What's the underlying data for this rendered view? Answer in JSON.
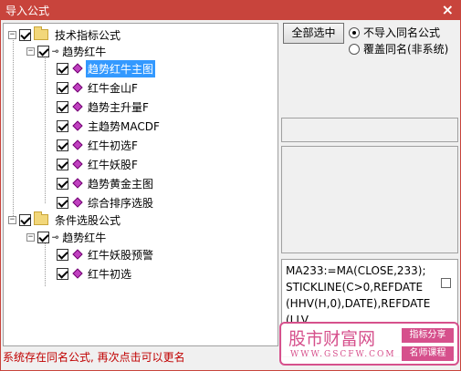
{
  "window": {
    "title": "导入公式",
    "close_label": "×"
  },
  "tree": {
    "root1": {
      "label": "技术指标公式",
      "expander": "−",
      "group": {
        "label": "趋势红牛",
        "expander": "−",
        "items": [
          {
            "label": "趋势红牛主图",
            "selected": true
          },
          {
            "label": "红牛金山F"
          },
          {
            "label": "趋势主升量F"
          },
          {
            "label": "主趋势MACDF"
          },
          {
            "label": "红牛初选F"
          },
          {
            "label": "红牛妖股F"
          },
          {
            "label": "趋势黄金主图"
          },
          {
            "label": "综合排序选股"
          }
        ]
      }
    },
    "root2": {
      "label": "条件选股公式",
      "expander": "−",
      "group": {
        "label": "趋势红牛",
        "expander": "−",
        "items": [
          {
            "label": "红牛妖股预警"
          },
          {
            "label": "红牛初选"
          }
        ]
      }
    }
  },
  "controls": {
    "select_all_label": "全部选中",
    "radio_skip_label": "不导入同名公式",
    "radio_overwrite_label": "覆盖同名(非系统)",
    "radio_selected": "skip"
  },
  "code_preview": {
    "lines": [
      "MA233:=MA(CLOSE,233);",
      "STICKLINE(C>0,REFDATE",
      "(HHV(H,0),DATE),REFDATE",
      "(LLV"
    ]
  },
  "status_text": "系统存在同名公式, 再次点击可以更名",
  "watermark": {
    "title": "股市财富网",
    "url": "WWW.GSCFW.COM",
    "tag1": "指标分享",
    "tag2": "名师课程"
  },
  "colors": {
    "titlebar": "#c8443c",
    "selection": "#3399ff",
    "status_text": "#c00000",
    "watermark": "#d6508c"
  }
}
